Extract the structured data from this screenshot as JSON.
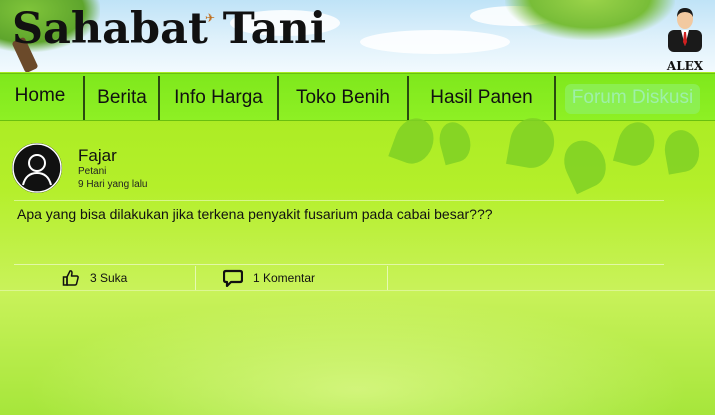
{
  "header": {
    "site_title": "Sahabat Tani",
    "user_name": "ALEX"
  },
  "nav": {
    "items": [
      {
        "label": "Home",
        "active": false
      },
      {
        "label": "Berita",
        "active": false
      },
      {
        "label": "Info Harga",
        "active": false
      },
      {
        "label": "Toko Benih",
        "active": false
      },
      {
        "label": "Hasil Panen",
        "active": false
      },
      {
        "label": "Forum Diskusi",
        "active": true
      }
    ]
  },
  "post": {
    "author": "Fajar",
    "role": "Petani",
    "time": "9 Hari yang lalu",
    "text": "Apa yang bisa dilakukan jika terkena penyakit fusarium pada cabai besar???",
    "likes_label": "3 Suka",
    "comments_label": "1 Komentar"
  },
  "icons": {
    "like": "thumbs-up-icon",
    "comment": "comment-icon",
    "avatar": "user-avatar-icon",
    "profile": "businessman-avatar-icon"
  },
  "colors": {
    "nav_bg": "#8ef024",
    "active_tab": "#9ef0a8",
    "text": "#111111"
  }
}
